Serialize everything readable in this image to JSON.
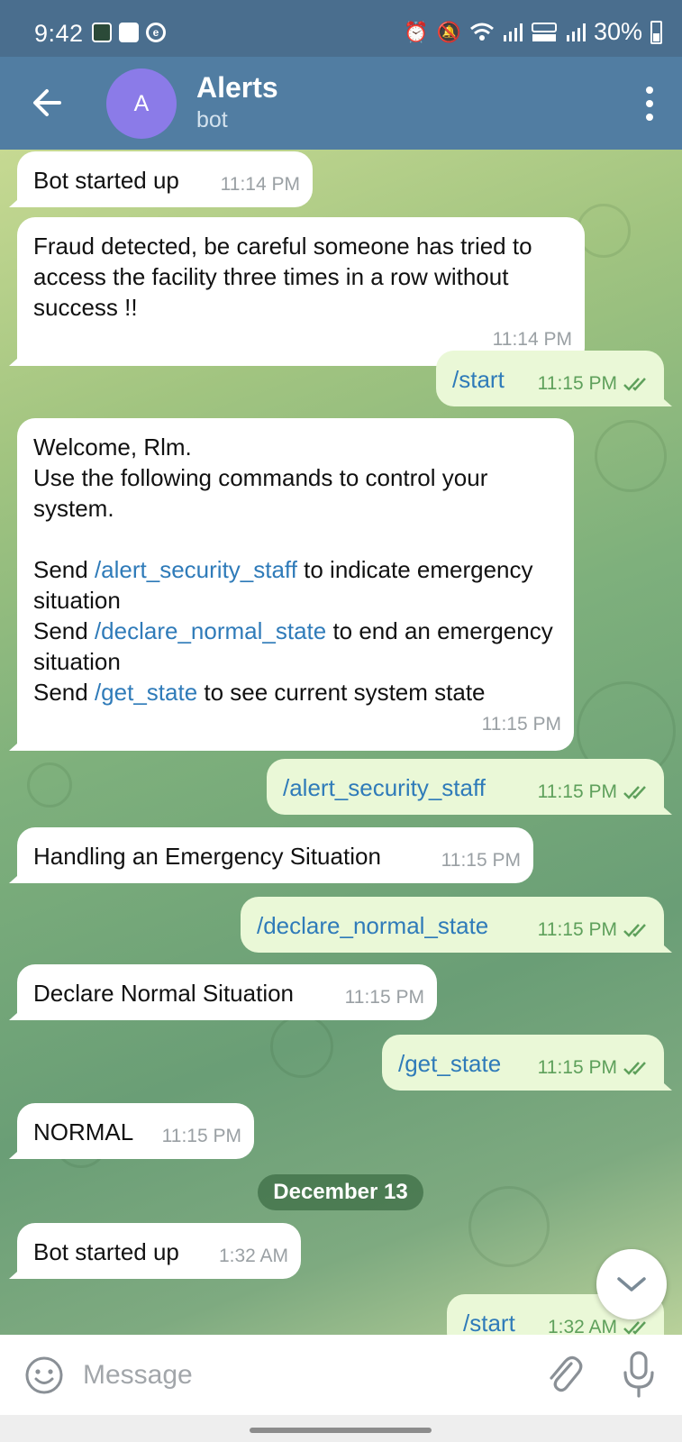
{
  "status_bar": {
    "time": "9:42",
    "battery": "30%",
    "icons_left": [
      "app-notification-icon",
      "checkbox-icon",
      "e-icon"
    ],
    "icons_right": [
      "alarm-icon",
      "mute-icon",
      "wifi-icon",
      "signal-icon",
      "volte-lte2-icon",
      "signal-icon",
      "battery-icon"
    ]
  },
  "header": {
    "avatar_letter": "A",
    "title": "Alerts",
    "subtitle": "bot"
  },
  "colors": {
    "appbar": "#517da2",
    "statusbar": "#4a6e8e",
    "avatar": "#8b7be8",
    "incoming_bubble": "#ffffff",
    "outgoing_bubble": "#eaf8d7",
    "command_link": "#2f7bb9",
    "read_check": "#5ea05b"
  },
  "messages": [
    {
      "dir": "in",
      "text": "Bot started up",
      "time": "11:14 PM"
    },
    {
      "dir": "in",
      "text": "Fraud detected, be careful someone has tried to access the facility three times in a row without success !!",
      "time": "11:14 PM"
    },
    {
      "dir": "out",
      "text": "/start",
      "time": "11:15 PM",
      "read": true
    },
    {
      "dir": "in",
      "intro": "Welcome, Rlm.\nUse the following commands to control your system.",
      "lines": [
        {
          "prefix": "Send ",
          "command": "/alert_security_staff",
          "suffix": " to indicate emergency situation"
        },
        {
          "prefix": "Send ",
          "command": "/declare_normal_state",
          "suffix": " to end an emergency situation"
        },
        {
          "prefix": "Send ",
          "command": "/get_state",
          "suffix": " to see current system state"
        }
      ],
      "time": "11:15 PM"
    },
    {
      "dir": "out",
      "text": "/alert_security_staff",
      "time": "11:15 PM",
      "read": true
    },
    {
      "dir": "in",
      "text": "Handling an Emergency Situation",
      "time": "11:15 PM"
    },
    {
      "dir": "out",
      "text": "/declare_normal_state",
      "time": "11:15 PM",
      "read": true
    },
    {
      "dir": "in",
      "text": "Declare Normal Situation",
      "time": "11:15 PM"
    },
    {
      "dir": "out",
      "text": "/get_state",
      "time": "11:15 PM",
      "read": true
    },
    {
      "dir": "in",
      "text": "NORMAL",
      "time": "11:15 PM"
    },
    {
      "dir": "in",
      "text": "Bot started up",
      "time": "1:32 AM"
    },
    {
      "dir": "out",
      "text": "/start",
      "time": "1:32 AM",
      "read": true
    }
  ],
  "date_separator": "December 13",
  "input": {
    "placeholder": "Message",
    "value": ""
  }
}
